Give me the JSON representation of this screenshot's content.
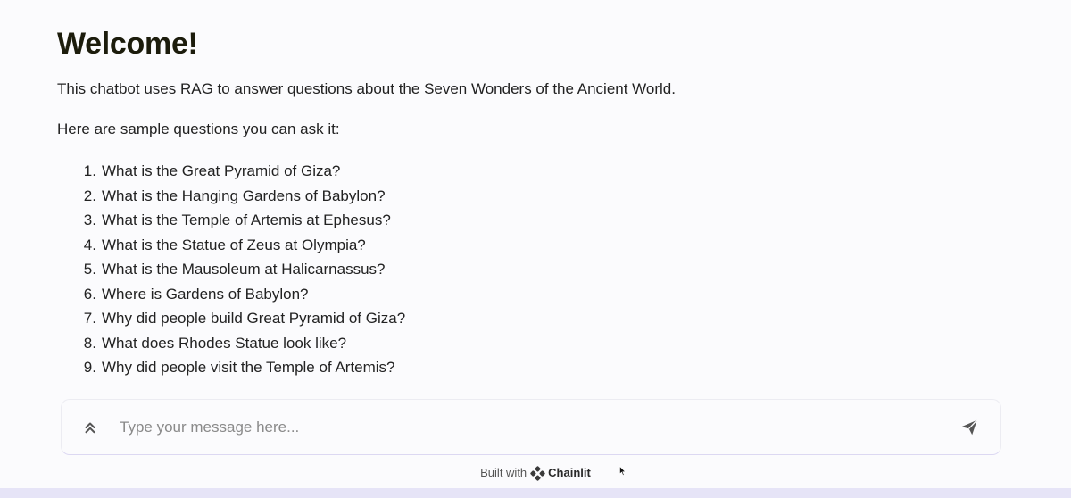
{
  "welcome": {
    "title": "Welcome!",
    "intro": "This chatbot uses RAG to answer questions about the Seven Wonders of the Ancient World.",
    "sample_heading": "Here are sample questions you can ask it:",
    "questions": [
      {
        "num": "1",
        "text": "What is the Great Pyramid of Giza?"
      },
      {
        "num": "2",
        "text": "What is the Hanging Gardens of Babylon?"
      },
      {
        "num": "3",
        "text": "What is the Temple of Artemis at Ephesus?"
      },
      {
        "num": "4",
        "text": "What is the Statue of Zeus at Olympia?"
      },
      {
        "num": "5",
        "text": "What is the Mausoleum at Halicarnassus?"
      },
      {
        "num": "6",
        "text": "Where is Gardens of Babylon?"
      },
      {
        "num": "7",
        "text": "Why did people build Great Pyramid of Giza?"
      },
      {
        "num": "8",
        "text": "What does Rhodes Statue look like?"
      },
      {
        "num": "9",
        "text": "Why did people visit the Temple of Artemis?"
      }
    ]
  },
  "composer": {
    "placeholder": "Type your message here...",
    "value": "",
    "expand_icon": "chevrons-up-icon",
    "send_icon": "send-icon"
  },
  "footer": {
    "built_with": "Built with",
    "brand": "Chainlit",
    "brand_icon": "chainlit-logo"
  },
  "colors": {
    "background": "#fbfbfd",
    "title": "#1c1c0c",
    "bottom_bar": "#e6e4f7",
    "icon": "#555555"
  }
}
